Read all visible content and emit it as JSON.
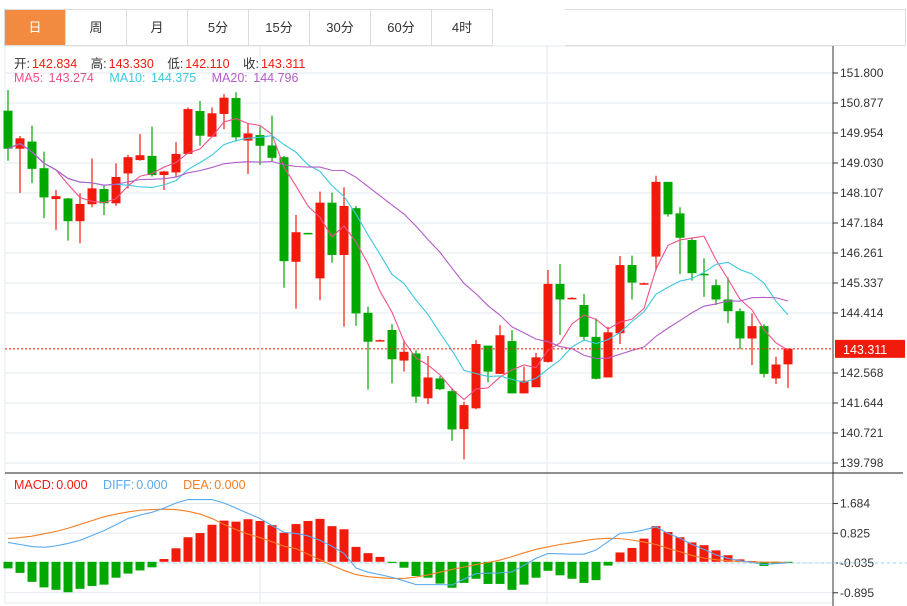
{
  "tabs": [
    {
      "label": "日",
      "active": true
    },
    {
      "label": "周"
    },
    {
      "label": "月"
    },
    {
      "label": "5分"
    },
    {
      "label": "15分"
    },
    {
      "label": "30分"
    },
    {
      "label": "60分"
    },
    {
      "label": "4时"
    }
  ],
  "ohlc_info": {
    "open_label": "开:",
    "open": "142.834",
    "high_label": "高:",
    "high": "143.330",
    "low_label": "低:",
    "low": "142.110",
    "close_label": "收:",
    "close": "143.311"
  },
  "ma_info": {
    "ma5_label": "MA5:",
    "ma5": "143.274",
    "ma10_label": "MA10:",
    "ma10": "144.375",
    "ma20_label": "MA20:",
    "ma20": "144.796"
  },
  "macd_info": {
    "macd_label": "MACD:",
    "macd": "0.000",
    "diff_label": "DIFF:",
    "diff": "0.000",
    "dea_label": "DEA:",
    "dea": "0.000"
  },
  "colors": {
    "up": "#f21a0b",
    "down": "#00a800",
    "ma5": "#f0508a",
    "ma10": "#3cc8e0",
    "ma20": "#b45cc8",
    "diff": "#5aaaf0",
    "dea": "#f57f25",
    "accent": "#f28a40"
  },
  "chart_data": [
    {
      "type": "candlestick",
      "price_ticks": [
        "151.800",
        "150.877",
        "149.954",
        "149.030",
        "148.107",
        "147.184",
        "146.261",
        "145.337",
        "144.414",
        "142.568",
        "141.644",
        "140.721",
        "139.798"
      ],
      "ylim": [
        139.798,
        151.8
      ],
      "last_price": "143.311",
      "ma_periods": [
        5,
        10,
        20
      ],
      "candles": [
        [
          150.64,
          151.28,
          149.1,
          149.47
        ],
        [
          149.47,
          149.86,
          148.11,
          149.79
        ],
        [
          149.69,
          150.18,
          148.41,
          148.85
        ],
        [
          148.87,
          149.38,
          147.33,
          147.97
        ],
        [
          147.92,
          148.2,
          146.97,
          148.01
        ],
        [
          147.94,
          147.95,
          146.64,
          147.24
        ],
        [
          147.24,
          148.1,
          146.56,
          147.77
        ],
        [
          147.76,
          149.17,
          147.67,
          148.25
        ],
        [
          148.23,
          148.35,
          147.43,
          147.79
        ],
        [
          147.79,
          149.02,
          147.71,
          148.6
        ],
        [
          148.71,
          149.28,
          148.25,
          149.21
        ],
        [
          149.12,
          149.92,
          149.1,
          149.27
        ],
        [
          149.25,
          150.15,
          148.61,
          148.66
        ],
        [
          148.66,
          148.79,
          148.2,
          148.77
        ],
        [
          148.74,
          149.67,
          148.59,
          149.31
        ],
        [
          149.31,
          150.74,
          149.31,
          150.69
        ],
        [
          150.63,
          150.94,
          149.56,
          149.87
        ],
        [
          149.84,
          150.74,
          149.84,
          150.56
        ],
        [
          150.54,
          151.15,
          150.07,
          151.04
        ],
        [
          151.03,
          151.21,
          149.69,
          149.82
        ],
        [
          149.72,
          150.25,
          148.69,
          149.94
        ],
        [
          149.89,
          150.15,
          148.97,
          149.56
        ],
        [
          149.57,
          150.49,
          149.09,
          149.19
        ],
        [
          149.21,
          149.25,
          145.19,
          146.01
        ],
        [
          145.99,
          147.43,
          144.55,
          146.9
        ],
        [
          146.88,
          146.88,
          146.87,
          146.87
        ],
        [
          145.48,
          148.15,
          144.81,
          147.81
        ],
        [
          147.81,
          148.12,
          145.96,
          146.2
        ],
        [
          146.2,
          148.28,
          143.99,
          147.71
        ],
        [
          147.64,
          147.71,
          144.02,
          144.4
        ],
        [
          144.42,
          144.61,
          142.06,
          143.53
        ],
        [
          143.58,
          143.6,
          143.56,
          143.58
        ],
        [
          143.89,
          144.07,
          142.25,
          142.99
        ],
        [
          142.95,
          143.58,
          142.61,
          143.22
        ],
        [
          143.17,
          143.27,
          141.65,
          141.84
        ],
        [
          141.79,
          143.09,
          141.61,
          142.43
        ],
        [
          142.4,
          142.47,
          142.04,
          142.07
        ],
        [
          142.01,
          142.1,
          140.48,
          140.83
        ],
        [
          140.84,
          141.68,
          139.91,
          141.58
        ],
        [
          141.48,
          143.58,
          141.45,
          143.46
        ],
        [
          143.41,
          143.41,
          142.28,
          142.61
        ],
        [
          142.54,
          144.04,
          142.54,
          143.73
        ],
        [
          143.55,
          143.89,
          141.94,
          141.94
        ],
        [
          141.94,
          142.76,
          141.94,
          142.33
        ],
        [
          142.13,
          143.19,
          142.13,
          143.05
        ],
        [
          142.91,
          145.74,
          142.89,
          145.31
        ],
        [
          145.31,
          145.92,
          143.74,
          144.83
        ],
        [
          144.88,
          144.9,
          144.86,
          144.88
        ],
        [
          144.66,
          145.0,
          143.58,
          143.68
        ],
        [
          143.68,
          144.25,
          142.37,
          142.39
        ],
        [
          142.43,
          143.99,
          142.43,
          143.82
        ],
        [
          143.79,
          146.17,
          143.46,
          145.89
        ],
        [
          145.89,
          146.18,
          144.83,
          145.35
        ],
        [
          145.33,
          145.35,
          145.31,
          145.33
        ],
        [
          146.15,
          148.64,
          145.72,
          148.45
        ],
        [
          148.45,
          148.45,
          147.38,
          147.45
        ],
        [
          147.48,
          147.67,
          145.61,
          146.73
        ],
        [
          146.66,
          146.74,
          145.41,
          145.64
        ],
        [
          145.62,
          146.1,
          144.91,
          145.61
        ],
        [
          145.27,
          145.45,
          144.66,
          144.83
        ],
        [
          144.83,
          145.51,
          144.1,
          144.47
        ],
        [
          144.47,
          144.56,
          143.3,
          143.63
        ],
        [
          143.63,
          144.4,
          142.81,
          144.01
        ],
        [
          144.01,
          144.07,
          142.43,
          142.54
        ],
        [
          142.4,
          143.07,
          142.23,
          142.83
        ],
        [
          142.834,
          143.33,
          142.11,
          143.311
        ]
      ]
    },
    {
      "type": "bar+line",
      "title": "MACD",
      "ticks": [
        "1.684",
        "0.825",
        "-0.035",
        "-0.895"
      ],
      "ylim": [
        -1.05,
        2.05
      ],
      "macd": [
        -0.19,
        -0.32,
        -0.58,
        -0.74,
        -0.81,
        -0.88,
        -0.78,
        -0.7,
        -0.66,
        -0.46,
        -0.34,
        -0.25,
        -0.16,
        0.08,
        0.39,
        0.71,
        0.83,
        1.07,
        1.19,
        1.16,
        1.23,
        1.18,
        1.06,
        0.84,
        1.09,
        1.18,
        1.24,
        1.03,
        0.94,
        0.43,
        0.25,
        0.14,
        -0.03,
        -0.17,
        -0.41,
        -0.46,
        -0.63,
        -0.75,
        -0.61,
        -0.49,
        -0.64,
        -0.64,
        -0.81,
        -0.66,
        -0.46,
        -0.26,
        -0.39,
        -0.49,
        -0.61,
        -0.53,
        -0.11,
        0.27,
        0.4,
        0.67,
        1.03,
        0.86,
        0.71,
        0.56,
        0.48,
        0.33,
        0.19,
        0.07,
        0.02,
        -0.12,
        -0.05,
        -0.03
      ],
      "diff": [
        0.56,
        0.5,
        0.44,
        0.42,
        0.46,
        0.53,
        0.62,
        0.76,
        0.9,
        1.07,
        1.25,
        1.35,
        1.43,
        1.55,
        1.7,
        1.8,
        1.8,
        1.8,
        1.7,
        1.55,
        1.4,
        1.25,
        1.05,
        0.85,
        0.82,
        0.75,
        0.62,
        0.45,
        0.24,
        -0.18,
        -0.3,
        -0.37,
        -0.45,
        -0.55,
        -0.66,
        -0.66,
        -0.66,
        -0.67,
        -0.5,
        -0.34,
        -0.33,
        -0.32,
        -0.29,
        -0.1,
        0.1,
        0.24,
        0.23,
        0.22,
        0.22,
        0.34,
        0.58,
        0.82,
        0.85,
        0.92,
        1.01,
        0.82,
        0.68,
        0.5,
        0.36,
        0.2,
        0.1,
        0.03,
        -0.02,
        -0.08,
        -0.05,
        -0.03
      ],
      "dea": [
        0.67,
        0.7,
        0.74,
        0.81,
        0.88,
        0.97,
        1.08,
        1.19,
        1.3,
        1.38,
        1.44,
        1.49,
        1.51,
        1.52,
        1.51,
        1.46,
        1.38,
        1.25,
        1.08,
        0.93,
        0.8,
        0.7,
        0.58,
        0.45,
        0.38,
        0.22,
        0.06,
        -0.1,
        -0.25,
        -0.37,
        -0.43,
        -0.46,
        -0.48,
        -0.48,
        -0.44,
        -0.38,
        -0.3,
        -0.22,
        -0.15,
        -0.08,
        -0.02,
        0.05,
        0.15,
        0.26,
        0.36,
        0.43,
        0.5,
        0.55,
        0.61,
        0.66,
        0.68,
        0.67,
        0.63,
        0.57,
        0.5,
        0.39,
        0.29,
        0.18,
        0.11,
        0.06,
        0.03,
        0.01,
        0.0,
        -0.01,
        -0.01,
        -0.02
      ]
    }
  ]
}
